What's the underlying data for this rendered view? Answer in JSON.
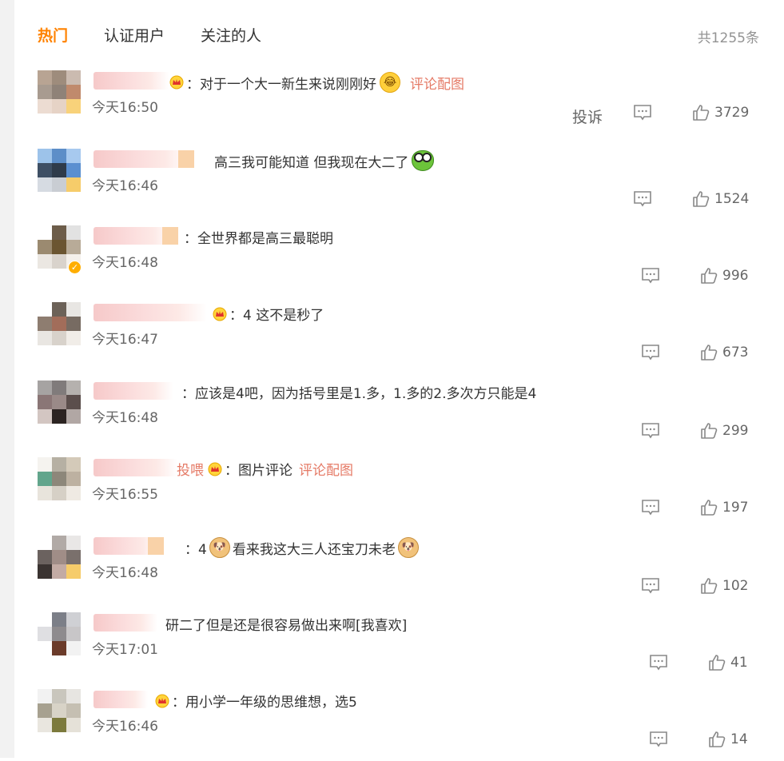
{
  "tabs": [
    {
      "label": "热门",
      "active": true
    },
    {
      "label": "认证用户",
      "active": false
    },
    {
      "label": "关注的人",
      "active": false
    }
  ],
  "total": "共1255条",
  "report_label": "投诉",
  "comments": [
    {
      "text": "：对于一个大一新生来说刚刚好",
      "link": "评论配图",
      "time": "今天16:50",
      "likes": "3729"
    },
    {
      "text": "高三我可能知道 但我现在大二了",
      "time": "今天16:46",
      "likes": "1524"
    },
    {
      "text": "：全世界都是高三最聪明",
      "time": "今天16:48",
      "likes": "996"
    },
    {
      "text": "：4 这不是秒了",
      "time": "今天16:47",
      "likes": "673"
    },
    {
      "text": "：应该是4吧，因为括号里是1.多，1.多的2.多次方只能是4",
      "time": "今天16:48",
      "likes": "299"
    },
    {
      "name_fragment": "投喂",
      "text": "：图片评论",
      "link": "评论配图",
      "time": "今天16:55",
      "likes": "197"
    },
    {
      "text_a": "：4",
      "text_b": "看来我这大三人还宝刀未老",
      "time": "今天16:48",
      "likes": "102"
    },
    {
      "text": "研二了但是还是很容易做出来啊[我喜欢]",
      "time": "今天17:01",
      "likes": "41"
    },
    {
      "text": "：用小学一年级的思维想，选5",
      "time": "今天16:46",
      "likes": "14"
    }
  ],
  "colors": {
    "accent": "#ff8200",
    "link": "#e57a66",
    "muted": "#939393"
  }
}
